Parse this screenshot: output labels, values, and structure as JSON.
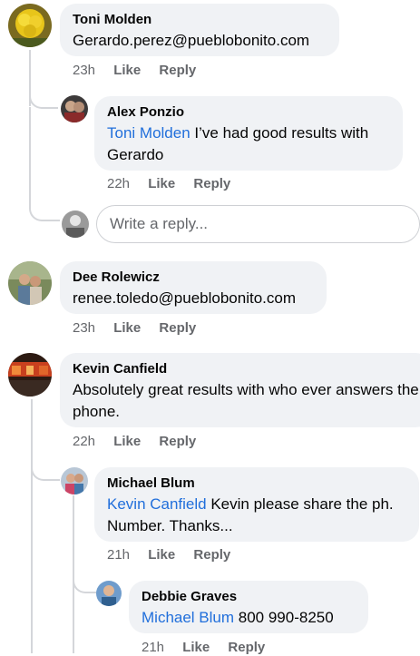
{
  "comments": [
    {
      "author": "Toni Molden",
      "text": "Gerardo.perez@pueblobonito.com",
      "time": "23h",
      "like": "Like",
      "reply": "Reply",
      "replies": [
        {
          "author": "Alex Ponzio",
          "mention": "Toni Molden",
          "text": " I’ve had good results with Gerardo",
          "time": "22h",
          "like": "Like",
          "reply": "Reply"
        }
      ],
      "reply_box_placeholder": "Write a reply..."
    },
    {
      "author": "Dee Rolewicz",
      "text": "renee.toledo@pueblobonito.com",
      "time": "23h",
      "like": "Like",
      "reply": "Reply"
    },
    {
      "author": "Kevin Canfield",
      "text": "Absolutely great results with who ever answers the phone.",
      "time": "22h",
      "like": "Like",
      "reply": "Reply",
      "replies": [
        {
          "author": "Michael Blum",
          "mention": "Kevin Canfield",
          "text": " Kevin please share the ph. Number.  Thanks...",
          "time": "21h",
          "like": "Like",
          "reply": "Reply",
          "replies": [
            {
              "author": "Debbie Graves",
              "mention": "Michael Blum",
              "text": " 800 990-8250",
              "time": "21h",
              "like": "Like",
              "reply": "Reply"
            }
          ]
        }
      ]
    }
  ],
  "colors": {
    "bubble": "#f0f2f5",
    "mention": "#216fdb",
    "meta": "#65676b",
    "thread": "#d4d6da"
  }
}
